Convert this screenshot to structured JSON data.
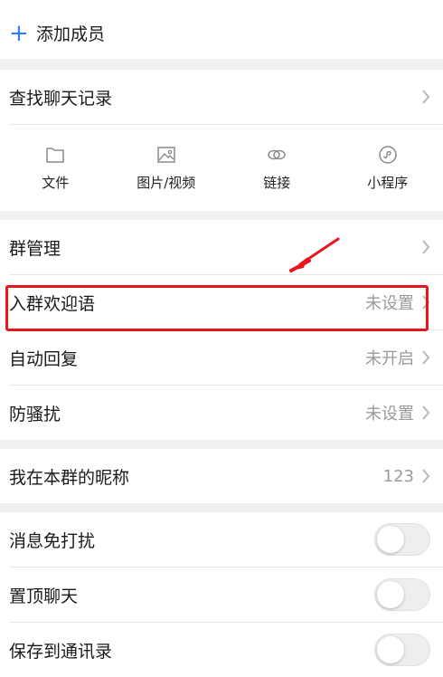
{
  "add_member": {
    "label": "添加成员"
  },
  "search_history": {
    "label": "查找聊天记录"
  },
  "media": [
    {
      "label": "文件",
      "icon": "folder-icon"
    },
    {
      "label": "图片/视频",
      "icon": "image-icon"
    },
    {
      "label": "链接",
      "icon": "link-icon"
    },
    {
      "label": "小程序",
      "icon": "mini-program-icon"
    }
  ],
  "group_settings": [
    {
      "label": "群管理",
      "value": ""
    },
    {
      "label": "入群欢迎语",
      "value": "未设置"
    },
    {
      "label": "自动回复",
      "value": "未开启"
    },
    {
      "label": "防骚扰",
      "value": "未设置"
    }
  ],
  "nickname": {
    "label": "我在本群的昵称",
    "value": "123"
  },
  "toggles": [
    {
      "label": "消息免打扰",
      "on": false
    },
    {
      "label": "置顶聊天",
      "on": false
    },
    {
      "label": "保存到通讯录",
      "on": false
    }
  ],
  "colors": {
    "accent": "#2f7df6",
    "annotation": "#e8151b"
  }
}
